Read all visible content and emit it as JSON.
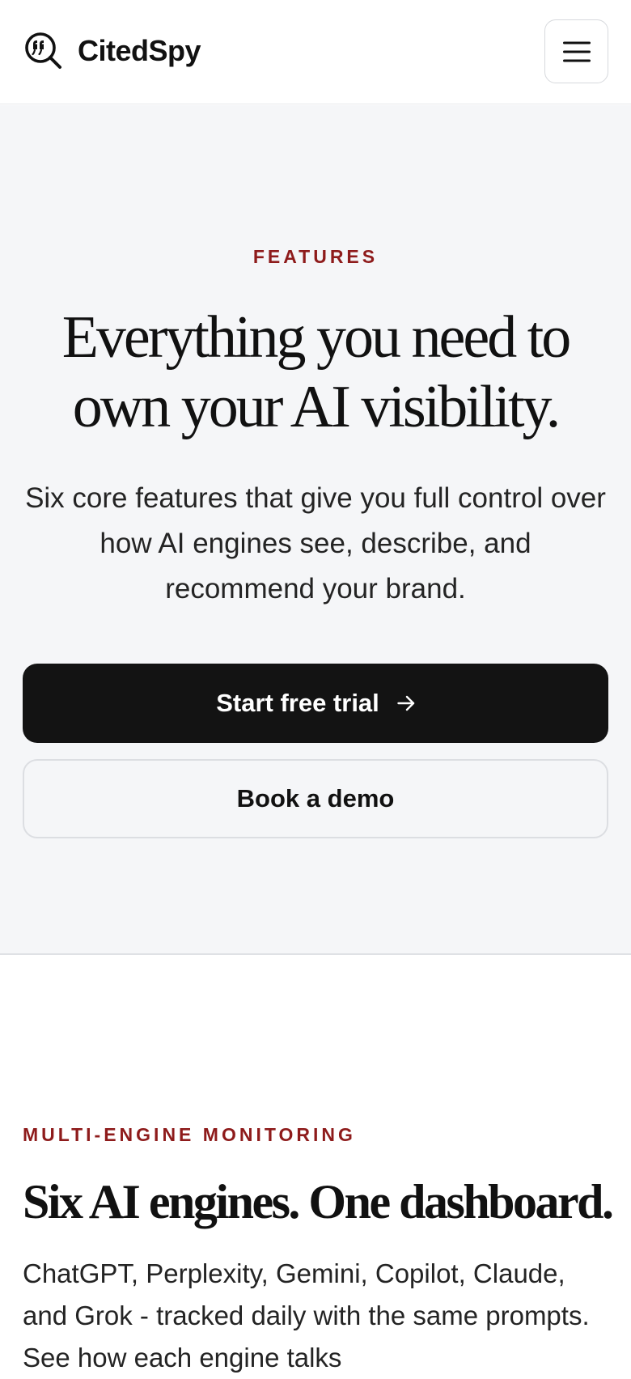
{
  "header": {
    "brand": "CitedSpy",
    "logo_icon": "quote-magnifier-icon",
    "menu_icon": "hamburger-menu-icon"
  },
  "hero": {
    "eyebrow": "FEATURES",
    "title": "Everything you need to own your AI visibility.",
    "subtitle": "Six core features that give you full control over how AI engines see, describe, and recommend your brand.",
    "primary_cta": "Start free trial",
    "primary_cta_icon": "arrow-right-icon",
    "secondary_cta": "Book a demo"
  },
  "section": {
    "eyebrow": "MULTI-ENGINE MONITORING",
    "title": "Six AI engines. One dashboard.",
    "body": "ChatGPT, Perplexity, Gemini, Copilot, Claude, and Grok - tracked daily with the same prompts. See how each engine talks"
  },
  "colors": {
    "accent": "#8e1b1b",
    "primary_button": "#131313",
    "hero_background": "#f5f6f8"
  }
}
